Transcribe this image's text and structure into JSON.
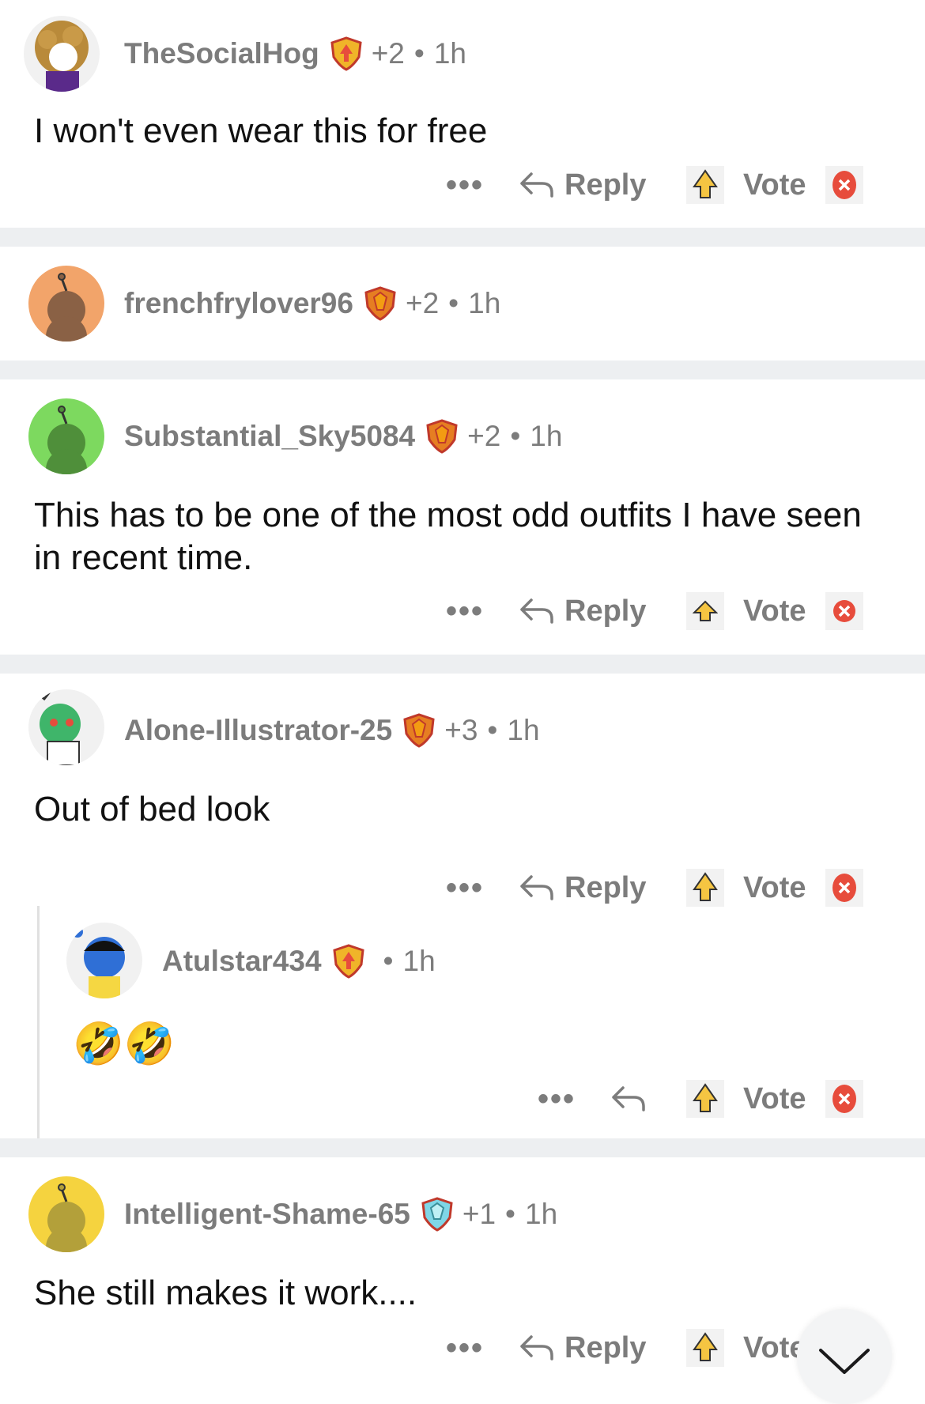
{
  "comments": [
    {
      "username": "TheSocialHog",
      "karma": "+2",
      "dot": "•",
      "time": "1h",
      "text": "I won't even wear this for free",
      "reply_label": "Reply",
      "vote_label": "Vote"
    },
    {
      "username": "frenchfrylover96",
      "karma": "+2",
      "dot": "•",
      "time": "1h"
    },
    {
      "username": "Substantial_Sky5084",
      "karma": "+2",
      "dot": "•",
      "time": "1h",
      "text": "This has to be one of the most odd outfits I have seen in recent time.",
      "reply_label": "Reply",
      "vote_label": "Vote"
    },
    {
      "username": "Alone-Illustrator-25",
      "karma": "+3",
      "dot": "•",
      "time": "1h",
      "text": "Out of bed look",
      "reply_label": "Reply",
      "vote_label": "Vote"
    },
    {
      "username": "Atulstar434",
      "dot": "•",
      "time": "1h",
      "text": "🤣🤣",
      "vote_label": "Vote"
    },
    {
      "username": "Intelligent-Shame-65",
      "karma": "+1",
      "dot": "•",
      "time": "1h",
      "text": "She still makes it work....",
      "reply_label": "Reply",
      "vote_label": "Vote"
    }
  ],
  "more_label": "•••",
  "icons": {
    "flair": "shield-flair-icon",
    "more": "more-options-icon",
    "reply": "reply-arrow-icon",
    "vote": "vote-arrow-icon",
    "downvote": "downvote-x-icon",
    "scroll": "chevron-down-icon"
  },
  "colors": {
    "meta_text": "#7c7c7c",
    "separator": "#edeff1",
    "vote_red": "#e74c3c",
    "vote_gold": "#f5c542"
  }
}
